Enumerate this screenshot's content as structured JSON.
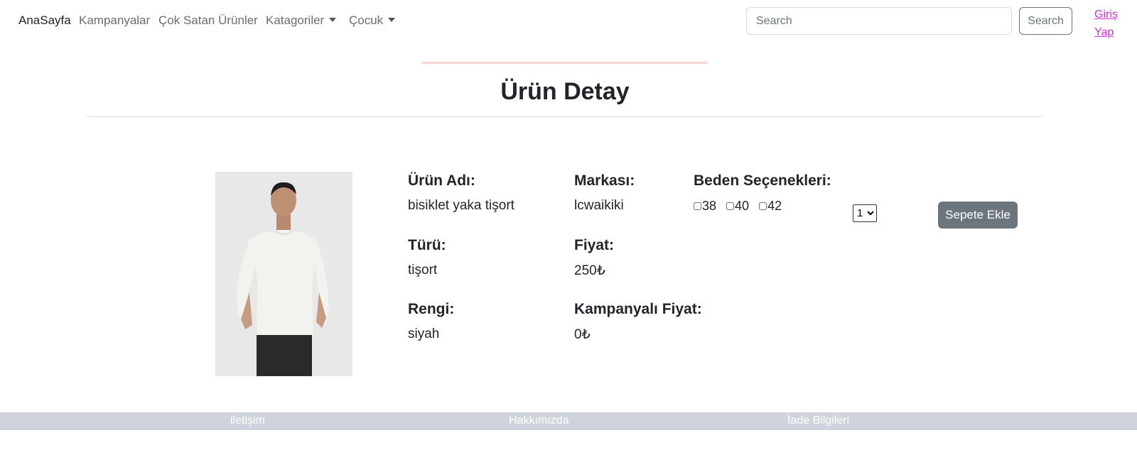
{
  "navbar": {
    "brand": "AnaSayfa",
    "links": [
      "Kampanyalar",
      "Çok Satan Ürünler"
    ],
    "dropdowns": [
      "Katagoriler",
      "Çocuk"
    ],
    "search_placeholder": "Search",
    "search_button": "Search",
    "login": "Giriş Yap"
  },
  "page": {
    "title": "Ürün Detay"
  },
  "product": {
    "image_description": "white t-shirt",
    "name_label": "Ürün Adı:",
    "name": "bisiklet yaka tişort",
    "brand_label": "Markası:",
    "brand": "lcwaikiki",
    "type_label": "Türü:",
    "type": "tişort",
    "price_label": "Fiyat:",
    "price": "250₺",
    "color_label": "Rengi:",
    "color": "siyah",
    "campaign_price_label": "Kampanyalı Fiyat:",
    "campaign_price": "0₺",
    "sizes_label": "Beden Seçenekleri:",
    "sizes": [
      "38",
      "40",
      "42"
    ],
    "quantity": "1",
    "add_to_cart": "Sepete Ekle"
  },
  "footer": {
    "links": [
      "iletişim",
      "Hakkımızda",
      "İade Bilgileri"
    ]
  },
  "colors": {
    "login_link": "#d42fd0",
    "add_button_bg": "#6c757d",
    "footer_bg": "#cfd4dc",
    "accent_line": "#f8d7d2"
  }
}
